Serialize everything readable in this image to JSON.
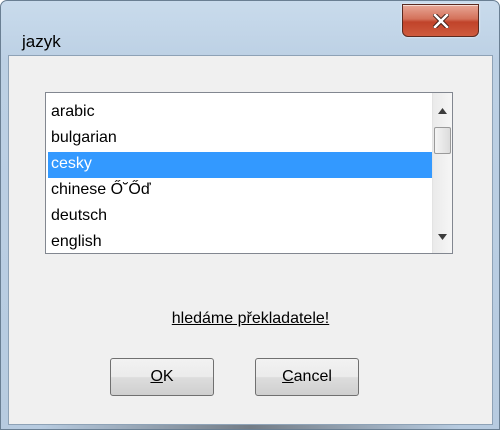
{
  "window": {
    "title": "jazyk",
    "close_icon": "close-x-icon",
    "close_color": "#c7442b"
  },
  "language_list": {
    "items": [
      {
        "label": "arabic",
        "selected": false
      },
      {
        "label": "bulgarian",
        "selected": false
      },
      {
        "label": "cesky",
        "selected": true
      },
      {
        "label": "chinese Ő˘Őď",
        "selected": false
      },
      {
        "label": "deutsch",
        "selected": false
      },
      {
        "label": "english",
        "selected": false
      }
    ],
    "selection_color": "#3399ff"
  },
  "link": {
    "text": "hledáme překladatele!"
  },
  "buttons": {
    "ok_mnemonic": "O",
    "ok_rest": "K",
    "cancel_mnemonic": "C",
    "cancel_rest": "ancel"
  }
}
